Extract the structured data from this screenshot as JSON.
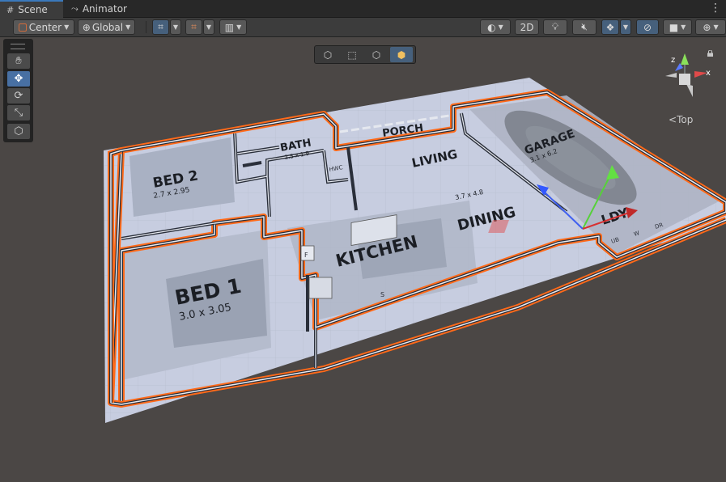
{
  "tabs": [
    {
      "label": "Scene",
      "icon": "grid-icon",
      "active": true
    },
    {
      "label": "Animator",
      "icon": "animator-icon",
      "active": false
    }
  ],
  "toolbar": {
    "pivot_label": "Center",
    "space_label": "Global",
    "mode_2d_label": "2D"
  },
  "tools": [
    "hand-tool",
    "move-tool",
    "rotate-tool",
    "scale-tool",
    "rect-tool"
  ],
  "active_tool": "move-tool",
  "gizmo": {
    "view_label": "Top",
    "axis_x": "x",
    "axis_y": "y",
    "axis_z": "z"
  },
  "floorplan": {
    "rooms": [
      {
        "name": "BED 2",
        "dims": "2.7 x 2.95"
      },
      {
        "name": "BATH",
        "dims": "2.5 x 1.9"
      },
      {
        "name": "PORCH",
        "dims": ""
      },
      {
        "name": "LIVING",
        "dims": ""
      },
      {
        "name": "DINING",
        "dims": "3.7 x 4.8"
      },
      {
        "name": "GARAGE",
        "dims": "3.1 x 6.2"
      },
      {
        "name": "BED 1",
        "dims": "3.0 x 3.05"
      },
      {
        "name": "KITCHEN",
        "dims": ""
      },
      {
        "name": "LDY",
        "dims": ""
      }
    ],
    "fixtures": [
      "HWC",
      "F",
      "S",
      "UB",
      "W",
      "DR"
    ]
  },
  "colors": {
    "selection_outline": "#ff6a1a",
    "floor": "#c9d0e2",
    "active_blue": "#46607c"
  }
}
